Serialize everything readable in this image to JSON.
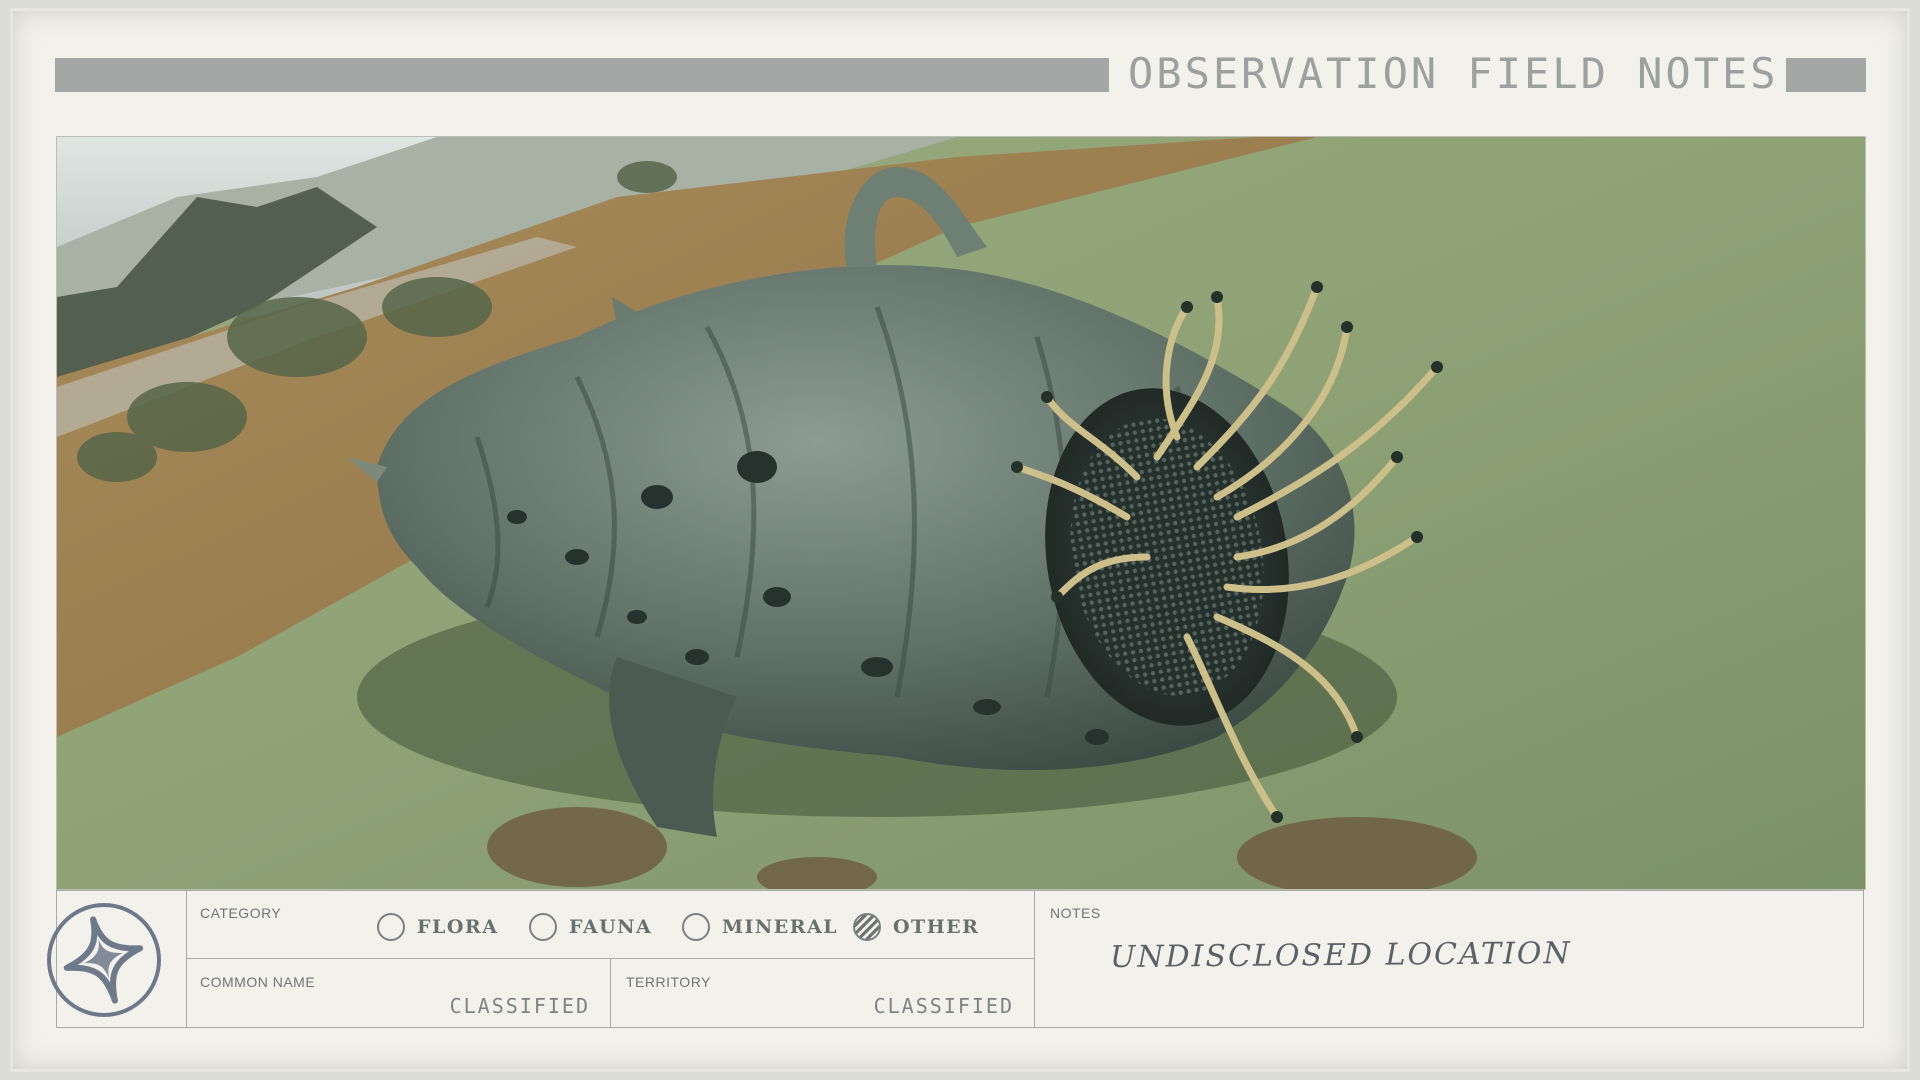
{
  "header": {
    "title": "OBSERVATION FIELD NOTES"
  },
  "photo": {
    "subject": "creature-photo"
  },
  "category": {
    "label": "CATEGORY",
    "options": [
      {
        "label": "FLORA",
        "checked": false
      },
      {
        "label": "FAUNA",
        "checked": false
      },
      {
        "label": "MINERAL",
        "checked": false
      },
      {
        "label": "OTHER",
        "checked": true
      }
    ]
  },
  "common_name": {
    "label": "COMMON NAME",
    "value": "CLASSIFIED"
  },
  "territory": {
    "label": "TERRITORY",
    "value": "CLASSIFIED"
  },
  "notes": {
    "label": "NOTES",
    "value": "UNDISCLOSED LOCATION"
  },
  "colors": {
    "paper": "#f2f1ec",
    "ink": "#6a706f",
    "header_bar": "#a3a7a6"
  },
  "icons": {
    "emblem": "star-compass-emblem-icon"
  }
}
